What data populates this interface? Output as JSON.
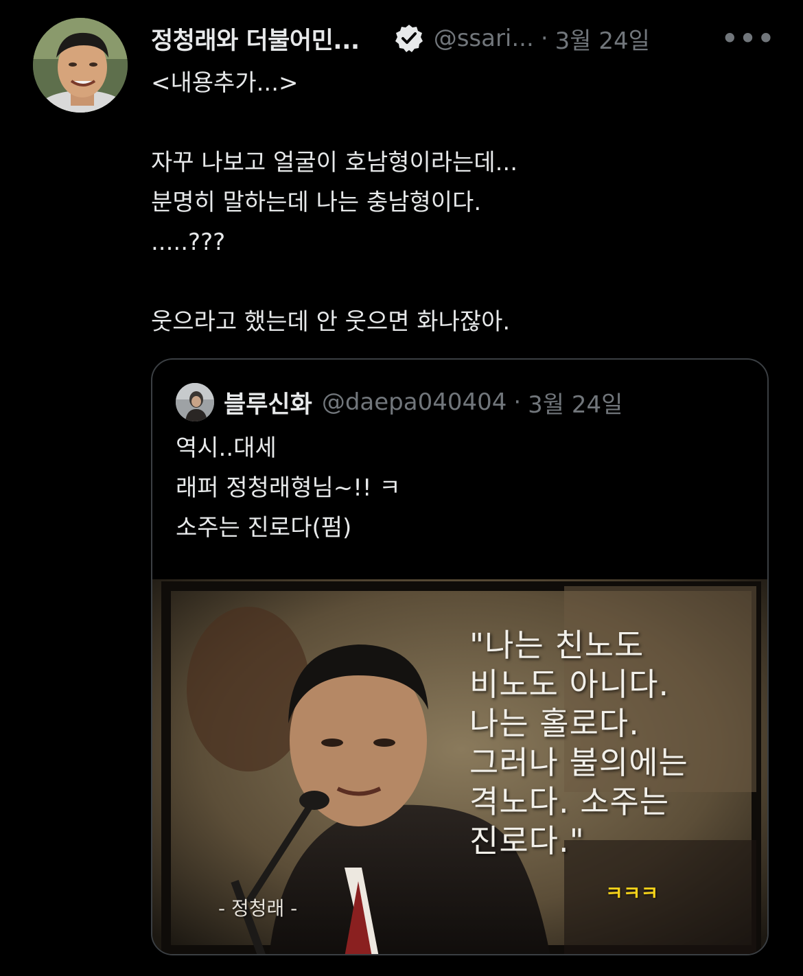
{
  "tweet": {
    "author": {
      "name": "정청래와 더불어민...",
      "handle": "@ssari...",
      "verified": true
    },
    "dot": "·",
    "date": "3월 24일",
    "more": "•••",
    "body_lines": [
      "<내용추가...>",
      "",
      "자꾸 나보고 얼굴이 호남형이라는데...",
      "분명히 말하는데 나는 충남형이다.",
      ".....???",
      "",
      "웃으라고 했는데 안 웃으면 화나잖아."
    ]
  },
  "quote": {
    "author": {
      "name": "블루신화",
      "handle": "@daepa040404"
    },
    "dot": "·",
    "date": "3월 24일",
    "body_lines": [
      "역시..대세",
      "래퍼 정청래형님~!! ㅋ",
      "소주는 진로다(펌)"
    ],
    "image": {
      "overlay_lines": [
        "\"나는 친노도",
        "비노도 아니다.",
        "나는 홀로다.",
        "그러나 불의에는",
        "격노다. 소주는",
        "진로다.\""
      ],
      "caption": "- 정청래 -",
      "laugh": "ㅋㅋㅋ"
    }
  },
  "colors": {
    "background": "#000000",
    "text": "#e7e9ea",
    "secondary": "#71767b",
    "border": "#3b3f43",
    "laugh": "#f5d21a"
  }
}
